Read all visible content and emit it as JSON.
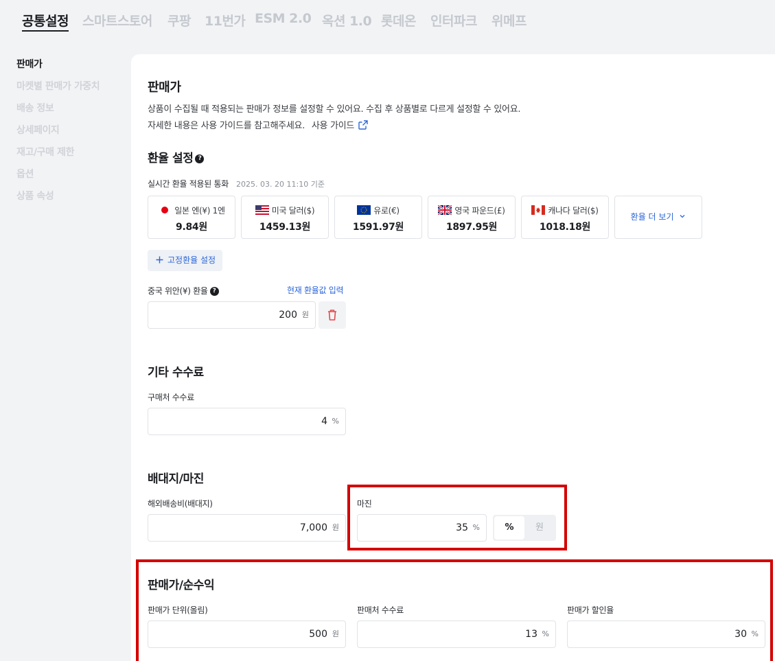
{
  "top_tabs": [
    "공통설정",
    "스마트스토어",
    "쿠팡",
    "11번가",
    "ESM 2.0",
    "옥션 1.0",
    "롯데온",
    "인터파크",
    "위메프"
  ],
  "side_nav": [
    "판매가",
    "마켓별 판매가 가중치",
    "배송 정보",
    "상세페이지",
    "재고/구매 제한",
    "옵션",
    "상품 속성"
  ],
  "price_section": {
    "title": "판매가",
    "desc1": "상품이 수집될 때 적용되는 판매가 정보를 설정할 수 있어요. 수집 후 상품별로 다르게 설정할 수 있어요.",
    "desc2": "자세한 내용은 사용 가이드를 참고해주세요.",
    "guide_link": "사용 가이드"
  },
  "exchange": {
    "title": "환율 설정",
    "realtime_label": "실시간 환율 적용된 통화",
    "timestamp": "2025. 03. 20 11:10 기준",
    "cards": [
      {
        "name": "일본 엔(¥) 1엔",
        "value": "9.84원"
      },
      {
        "name": "미국 달러($)",
        "value": "1459.13원"
      },
      {
        "name": "유로(€)",
        "value": "1591.97원"
      },
      {
        "name": "영국 파운드(£)",
        "value": "1897.95원"
      },
      {
        "name": "캐나다 달러($)",
        "value": "1018.18원"
      }
    ],
    "more": "환율 더 보기",
    "fixed_button": "고정환율 설정",
    "cny_label": "중국 위안(¥) 환율",
    "cny_link": "현재 환율값 입력",
    "cny_value": "200",
    "cny_unit": "원"
  },
  "fees": {
    "title": "기타 수수료",
    "purchase_label": "구매처 수수료",
    "purchase_value": "4",
    "purchase_unit": "%"
  },
  "margin": {
    "title": "배대지/마진",
    "shipping_label": "해외배송비(배대지)",
    "shipping_value": "7,000",
    "shipping_unit": "원",
    "margin_label": "마진",
    "margin_value": "35",
    "margin_unit": "%",
    "toggle_percent": "%",
    "toggle_won": "원"
  },
  "net": {
    "title": "판매가/순수익",
    "unit_label": "판매가 단위(올림)",
    "unit_value": "500",
    "unit_unit": "원",
    "seller_fee_label": "판매처 수수료",
    "seller_fee_value": "13",
    "seller_fee_unit": "%",
    "discount_label": "판매가 할인율",
    "discount_value": "30",
    "discount_unit": "%"
  },
  "colors": {
    "accent": "#2b66d9",
    "highlight": "#d40000",
    "text": "#1b1d21"
  }
}
